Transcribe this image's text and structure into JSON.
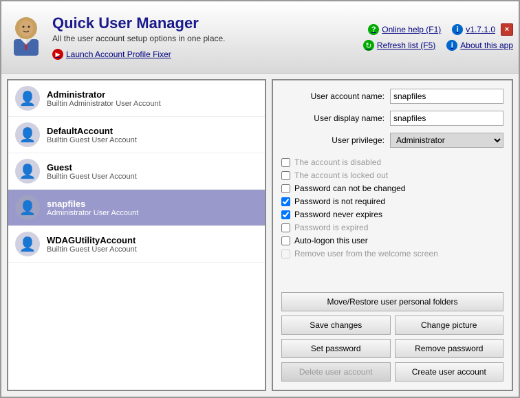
{
  "window": {
    "title": "Quick User Manager",
    "subtitle": "All the user account setup options in one place.",
    "launch_link": "Launch Account Profile Fixer",
    "close_label": "×",
    "version": "v1.7.1.0",
    "online_help": "Online help (F1)",
    "refresh_list": "Refresh list (F5)",
    "about": "About this app"
  },
  "users": [
    {
      "name": "Administrator",
      "desc": "Builtin Administrator User Account",
      "selected": false
    },
    {
      "name": "DefaultAccount",
      "desc": "Builtin Guest User Account",
      "selected": false
    },
    {
      "name": "Guest",
      "desc": "Builtin Guest User Account",
      "selected": false
    },
    {
      "name": "snapfiles",
      "desc": "Administrator User Account",
      "selected": true
    },
    {
      "name": "WDAGUtilityAccount",
      "desc": "Builtin Guest User Account",
      "selected": false
    }
  ],
  "form": {
    "account_name_label": "User account name:",
    "display_name_label": "User display name:",
    "privilege_label": "User privilege:",
    "account_name_value": "snapfiles",
    "display_name_value": "snapfiles",
    "privilege_value": "Administrator",
    "checkboxes": [
      {
        "label": "The account is disabled",
        "checked": false,
        "disabled": true
      },
      {
        "label": "The account is locked out",
        "checked": false,
        "disabled": true
      },
      {
        "label": "Password can not be changed",
        "checked": false,
        "disabled": false
      },
      {
        "label": "Password is not required",
        "checked": true,
        "disabled": false
      },
      {
        "label": "Password never expires",
        "checked": true,
        "disabled": false
      },
      {
        "label": "Password is expired",
        "checked": false,
        "disabled": true
      },
      {
        "label": "Auto-logon this user",
        "checked": false,
        "disabled": false
      },
      {
        "label": "Remove user from the welcome screen",
        "checked": false,
        "disabled": true
      }
    ]
  },
  "buttons": {
    "move_restore": "Move/Restore user personal folders",
    "save_changes": "Save changes",
    "change_picture": "Change picture",
    "set_password": "Set password",
    "remove_password": "Remove password",
    "delete_account": "Delete user account",
    "create_account": "Create user account"
  }
}
